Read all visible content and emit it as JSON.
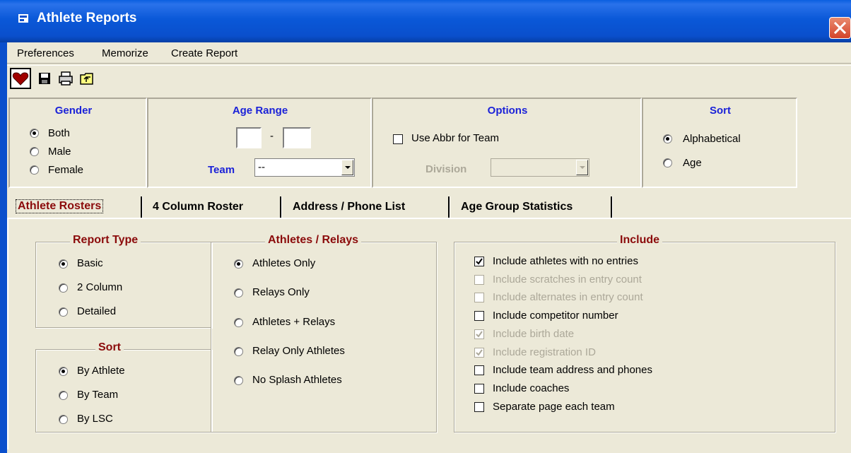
{
  "window": {
    "title": "Athlete Reports"
  },
  "menu": [
    "Preferences",
    "Memorize",
    "Create Report"
  ],
  "toolbar": {
    "icons": [
      "heart-icon",
      "save-icon",
      "print-icon",
      "folder-up-icon"
    ]
  },
  "gender": {
    "title": "Gender",
    "options": [
      "Both",
      "Male",
      "Female"
    ],
    "selected": "Both"
  },
  "age_range": {
    "title": "Age Range",
    "separator": "-",
    "from": "",
    "to": ""
  },
  "team": {
    "label": "Team",
    "value": "--"
  },
  "options": {
    "title": "Options",
    "use_abbr_label": "Use Abbr for Team",
    "use_abbr_checked": false,
    "division_label": "Division",
    "division_value": ""
  },
  "sort_top": {
    "title": "Sort",
    "options": [
      "Alphabetical",
      "Age"
    ],
    "selected": "Alphabetical"
  },
  "tabs": [
    "Athlete Rosters",
    "4 Column Roster",
    "Address / Phone List",
    "Age Group Statistics"
  ],
  "active_tab": "Athlete Rosters",
  "report_type": {
    "title": "Report Type",
    "options": [
      "Basic",
      "2 Column",
      "Detailed"
    ],
    "selected": "Basic"
  },
  "sort": {
    "title": "Sort",
    "options": [
      "By Athlete",
      "By Team",
      "By LSC"
    ],
    "selected": "By Athlete"
  },
  "athletes_relays": {
    "title": "Athletes / Relays",
    "options": [
      "Athletes Only",
      "Relays Only",
      "Athletes + Relays",
      "Relay Only Athletes",
      "No Splash Athletes"
    ],
    "selected": "Athletes Only"
  },
  "include": {
    "title": "Include",
    "items": [
      {
        "label": "Include athletes with no entries",
        "checked": true,
        "enabled": true
      },
      {
        "label": "Include scratches in entry count",
        "checked": false,
        "enabled": false
      },
      {
        "label": "Include alternates in entry count",
        "checked": false,
        "enabled": false
      },
      {
        "label": "Include competitor number",
        "checked": false,
        "enabled": true
      },
      {
        "label": "Include birth date",
        "checked": true,
        "enabled": false
      },
      {
        "label": "Include registration ID",
        "checked": true,
        "enabled": false
      },
      {
        "label": "Include team address and phones",
        "checked": false,
        "enabled": true
      },
      {
        "label": "Include coaches",
        "checked": false,
        "enabled": true
      },
      {
        "label": "Separate page each team",
        "checked": false,
        "enabled": true
      }
    ]
  }
}
